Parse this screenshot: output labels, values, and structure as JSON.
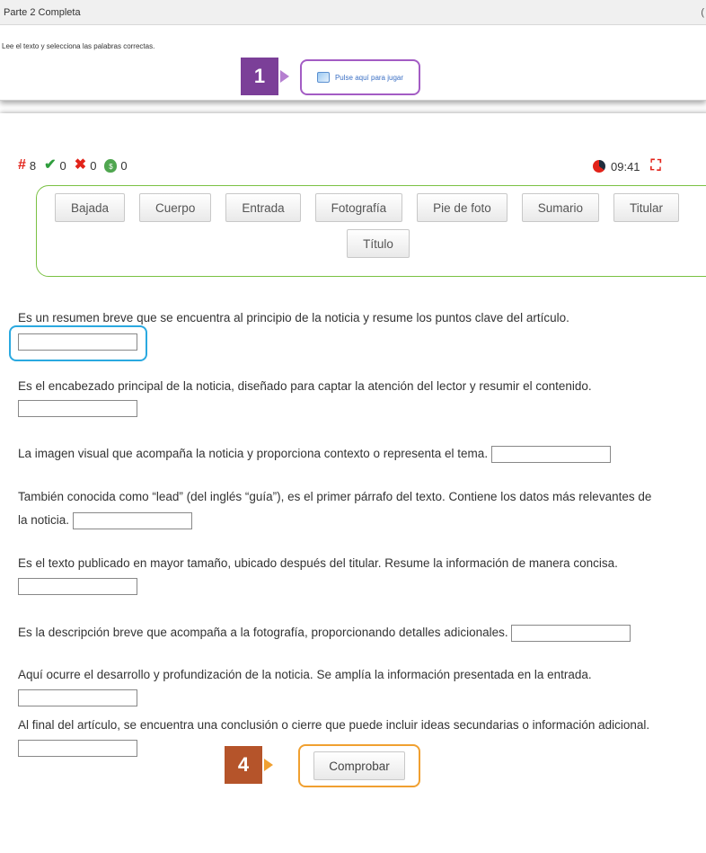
{
  "top": {
    "title": "Parte 2 Completa",
    "edge_char": "(",
    "instruction": "Lee el texto y selecciona las palabras correctas.",
    "step_badge": "1",
    "play_link": "Pulse aquí para jugar",
    "play_icon": "game-thumbnail-icon"
  },
  "stats": {
    "total": "8",
    "correct": "0",
    "wrong": "0",
    "score": "0",
    "icons": [
      "hash-icon",
      "check-icon",
      "x-icon",
      "money-bag-icon"
    ]
  },
  "timer": {
    "value": "09:41",
    "icon": "clock-icon",
    "exit_icon": "exit-fullscreen-icon"
  },
  "word_bank": [
    "Bajada",
    "Cuerpo",
    "Entrada",
    "Fotografía",
    "Pie de foto",
    "Sumario",
    "Titular",
    "Título"
  ],
  "questions": [
    {
      "text": "Es un resumen breve que se encuentra al principio de la noticia y resume los puntos clave del artículo.",
      "answer": ""
    },
    {
      "text": "Es el encabezado principal de la noticia, diseñado para captar la atención del lector y resumir el contenido.",
      "answer": ""
    },
    {
      "text": "La imagen visual que acompaña la noticia y proporciona contexto o representa el tema.",
      "answer": ""
    },
    {
      "text": "También conocida como “lead” (del inglés “guía”), es el primer párrafo del texto. Contiene los datos más relevantes de",
      "text_cont": "la noticia.",
      "answer": ""
    },
    {
      "text": "Es el texto publicado en mayor tamaño, ubicado después del titular. Resume la información de manera concisa.",
      "answer": ""
    },
    {
      "text": "Es la descripción breve que acompaña a la fotografía, proporcionando detalles adicionales.",
      "answer": ""
    },
    {
      "text": "Aquí ocurre el desarrollo y profundización de la noticia. Se amplía la información presentada en la entrada.",
      "answer": ""
    },
    {
      "text": "Al final del artículo, se encuentra una conclusión o cierre que puede incluir ideas secundarias o información adicional.",
      "answer": ""
    }
  ],
  "step_badge_4": "4",
  "check_button": "Comprobar",
  "colors": {
    "purple": "#7b3f98",
    "green": "#7ac143",
    "blue_focus": "#2aa9e0",
    "orange": "#f0a030",
    "red": "#e2231a"
  }
}
